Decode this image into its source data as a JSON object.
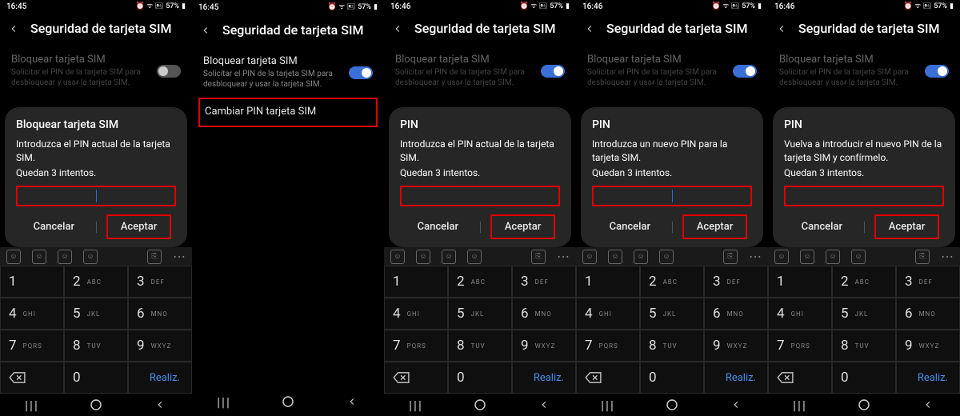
{
  "panes": [
    {
      "status": {
        "time": "16:45",
        "battery": "57%"
      },
      "header": {
        "title": "Seguridad de tarjeta SIM"
      },
      "lock": {
        "title": "Bloquear tarjeta SIM",
        "desc": "Solicitar el PIN de la tarjeta SIM para desbloquear y usar la tarjeta SIM.",
        "on": false,
        "dimmed": true
      },
      "faded_row": "",
      "dialog": {
        "title": "Bloquear tarjeta SIM",
        "msg": "Introduzca el PIN actual de la tarjeta SIM.",
        "attempts": "Quedan 3 intentos.",
        "caret": true,
        "cancel": "Cancelar",
        "accept": "Aceptar"
      },
      "has_keyboard": true,
      "change_pin": null
    },
    {
      "status": {
        "time": "16:45",
        "battery": "57%"
      },
      "header": {
        "title": "Seguridad de tarjeta SIM"
      },
      "lock": {
        "title": "Bloquear tarjeta SIM",
        "desc": "Solicitar el PIN de la tarjeta SIM para desbloquear y usar la tarjeta SIM.",
        "on": true,
        "dimmed": false
      },
      "faded_row": "",
      "dialog": null,
      "has_keyboard": false,
      "change_pin": {
        "title": "Cambiar PIN tarjeta SIM"
      }
    },
    {
      "status": {
        "time": "16:46",
        "battery": "57%"
      },
      "header": {
        "title": "Seguridad de tarjeta SIM"
      },
      "lock": {
        "title": "Bloquear tarjeta SIM",
        "desc": "Solicitar el PIN de la tarjeta SIM para desbloquear y usar la tarjeta SIM.",
        "on": true,
        "dimmed": true
      },
      "faded_row": "",
      "dialog": {
        "title": "PIN",
        "msg": "Introduzca el PIN actual de la tarjeta SIM.",
        "attempts": "Quedan 3 intentos.",
        "caret": false,
        "cancel": "Cancelar",
        "accept": "Aceptar"
      },
      "has_keyboard": true,
      "change_pin": null
    },
    {
      "status": {
        "time": "16:46",
        "battery": "57%"
      },
      "header": {
        "title": "Seguridad de tarjeta SIM"
      },
      "lock": {
        "title": "Bloquear tarjeta SIM",
        "desc": "Solicitar el PIN de la tarjeta SIM para desbloquear y usar la tarjeta SIM.",
        "on": true,
        "dimmed": true
      },
      "faded_row": "",
      "dialog": {
        "title": "PIN",
        "msg": "Introduzca un nuevo PIN para la tarjeta SIM.",
        "attempts": "Quedan 3 intentos.",
        "caret": true,
        "cancel": "Cancelar",
        "accept": "Aceptar"
      },
      "has_keyboard": true,
      "change_pin": null
    },
    {
      "status": {
        "time": "16:46",
        "battery": "57%"
      },
      "header": {
        "title": "Seguridad de tarjeta SIM"
      },
      "lock": {
        "title": "Bloquear tarjeta SIM",
        "desc": "Solicitar el PIN de la tarjeta SIM para desbloquear y usar la tarjeta SIM.",
        "on": true,
        "dimmed": true
      },
      "faded_row": "",
      "dialog": {
        "title": "PIN",
        "msg": "Vuelva a introducir el nuevo PIN de la tarjeta SIM y confírmelo.",
        "attempts": "Quedan 3 intentos.",
        "caret": false,
        "cancel": "Cancelar",
        "accept": "Aceptar"
      },
      "has_keyboard": true,
      "change_pin": null
    }
  ],
  "keypad": {
    "keys": [
      {
        "n": "1",
        "l": ""
      },
      {
        "n": "2",
        "l": "ABC"
      },
      {
        "n": "3",
        "l": "DEF"
      },
      {
        "n": "4",
        "l": "GHI"
      },
      {
        "n": "5",
        "l": "JKL"
      },
      {
        "n": "6",
        "l": "MNO"
      },
      {
        "n": "7",
        "l": "PQRS"
      },
      {
        "n": "8",
        "l": "TUV"
      },
      {
        "n": "9",
        "l": "WXYZ"
      }
    ],
    "zero": "0",
    "done": "Realiz."
  },
  "icons": {
    "status_glyphs": "⏰ ᯤ 🖭"
  }
}
